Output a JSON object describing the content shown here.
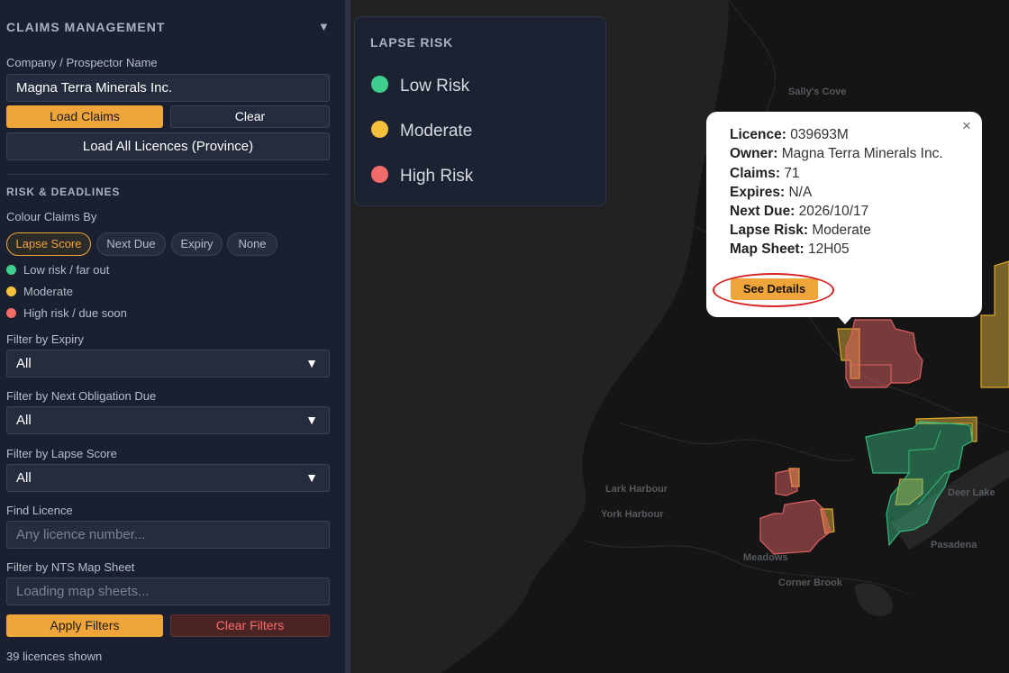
{
  "sidebar": {
    "title": "CLAIMS MANAGEMENT",
    "collapse_icon": "▼",
    "company_label": "Company / Prospector Name",
    "company_value": "Magna Terra Minerals Inc.",
    "load_claims": "Load Claims",
    "clear": "Clear",
    "load_all": "Load All Licences (Province)",
    "risk_section": "RISK & DEADLINES",
    "colour_by_label": "Colour Claims By",
    "chips": [
      "Lapse Score",
      "Next Due",
      "Expiry",
      "None"
    ],
    "active_chip": "Lapse Score",
    "legend": [
      {
        "label": "Low risk / far out",
        "color": "#3ecf8e"
      },
      {
        "label": "Moderate",
        "color": "#f5c13d"
      },
      {
        "label": "High risk / due soon",
        "color": "#f26b6b"
      }
    ],
    "expiry_label": "Filter by Expiry",
    "expiry_value": "All",
    "next_due_label": "Filter by Next Obligation Due",
    "next_due_value": "All",
    "lapse_label": "Filter by Lapse Score",
    "lapse_value": "All",
    "find_label": "Find Licence",
    "find_placeholder": "Any licence number...",
    "nts_label": "Filter by NTS Map Sheet",
    "nts_placeholder": "Loading map sheets...",
    "apply": "Apply Filters",
    "clear_filters": "Clear Filters",
    "count": "39 licences shown"
  },
  "map_legend": {
    "title": "LAPSE RISK",
    "items": [
      {
        "label": "Low Risk",
        "color": "#3ecf8e"
      },
      {
        "label": "Moderate",
        "color": "#f5c13d"
      },
      {
        "label": "High Risk",
        "color": "#f26b6b"
      }
    ]
  },
  "places": [
    "Sally's Cove",
    "Lark Harbour",
    "York Harbour",
    "Meadows",
    "Corner Brook",
    "Pasadena",
    "Deer Lake"
  ],
  "popup": {
    "licence_label": "Licence:",
    "licence": "039693M",
    "owner_label": "Owner:",
    "owner": "Magna Terra Minerals Inc.",
    "claims_label": "Claims:",
    "claims": "71",
    "expires_label": "Expires:",
    "expires": "N/A",
    "next_due_label": "Next Due:",
    "next_due": "2026/10/17",
    "lapse_label": "Lapse Risk:",
    "lapse": "Moderate",
    "sheet_label": "Map Sheet:",
    "sheet": "12H05",
    "see_details": "See Details",
    "close": "×"
  }
}
